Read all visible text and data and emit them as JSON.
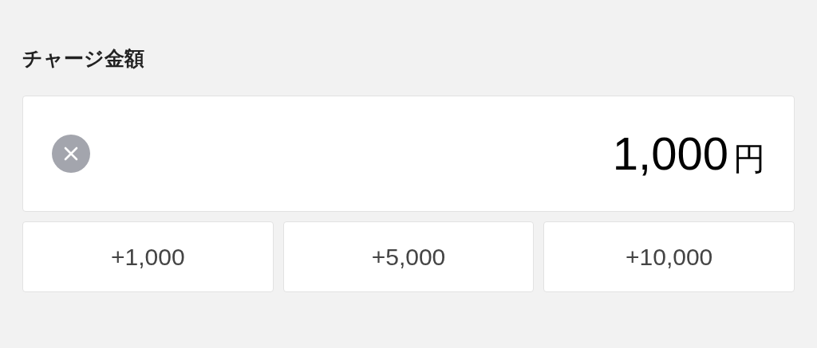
{
  "title": "チャージ金額",
  "amount": {
    "value": "1,000",
    "unit": "円"
  },
  "quick_add": [
    "+1,000",
    "+5,000",
    "+10,000"
  ]
}
